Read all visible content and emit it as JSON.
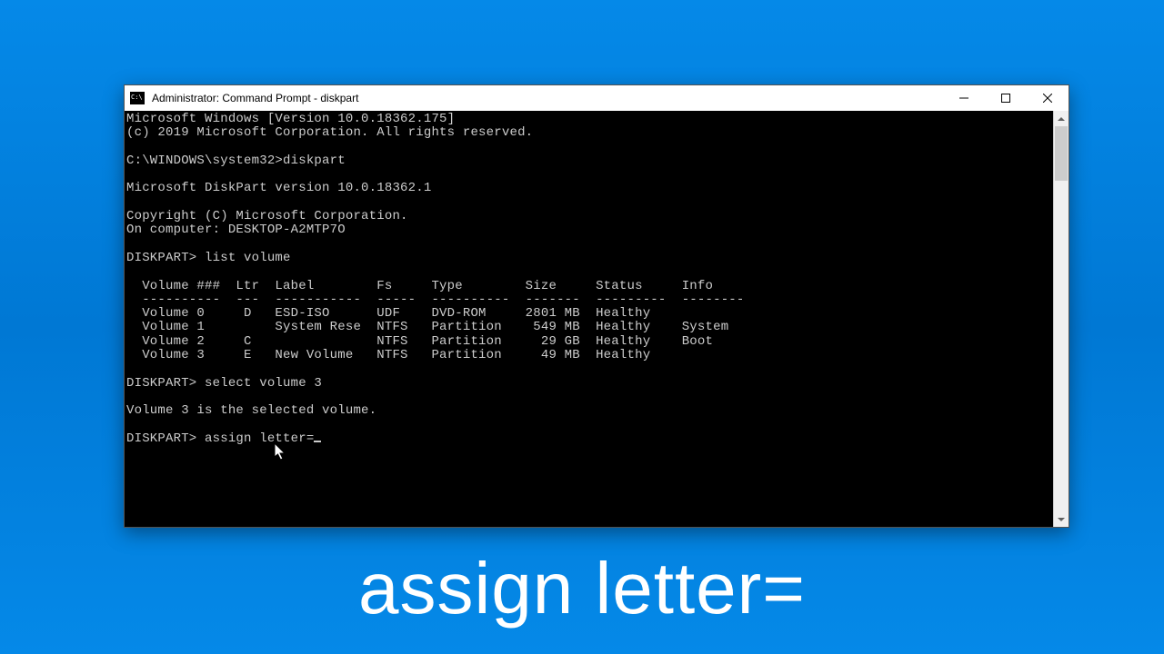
{
  "window": {
    "title": "Administrator: Command Prompt - diskpart"
  },
  "terminal": {
    "lines": [
      "Microsoft Windows [Version 10.0.18362.175]",
      "(c) 2019 Microsoft Corporation. All rights reserved.",
      "",
      "C:\\WINDOWS\\system32>diskpart",
      "",
      "Microsoft DiskPart version 10.0.18362.1",
      "",
      "Copyright (C) Microsoft Corporation.",
      "On computer: DESKTOP-A2MTP7O",
      "",
      "DISKPART> list volume",
      "",
      "  Volume ###  Ltr  Label        Fs     Type        Size     Status     Info",
      "  ----------  ---  -----------  -----  ----------  -------  ---------  --------",
      "  Volume 0     D   ESD-ISO      UDF    DVD-ROM     2801 MB  Healthy",
      "  Volume 1         System Rese  NTFS   Partition    549 MB  Healthy    System",
      "  Volume 2     C                NTFS   Partition     29 GB  Healthy    Boot",
      "  Volume 3     E   New Volume   NTFS   Partition     49 MB  Healthy",
      "",
      "DISKPART> select volume 3",
      "",
      "Volume 3 is the selected volume.",
      "",
      "DISKPART> assign letter="
    ],
    "prompt_prefix": "DISKPART> ",
    "current_input": "assign letter="
  },
  "volumes": [
    {
      "num": 0,
      "ltr": "D",
      "label": "ESD-ISO",
      "fs": "UDF",
      "type": "DVD-ROM",
      "size": "2801 MB",
      "status": "Healthy",
      "info": ""
    },
    {
      "num": 1,
      "ltr": "",
      "label": "System Rese",
      "fs": "NTFS",
      "type": "Partition",
      "size": "549 MB",
      "status": "Healthy",
      "info": "System"
    },
    {
      "num": 2,
      "ltr": "C",
      "label": "",
      "fs": "NTFS",
      "type": "Partition",
      "size": "29 GB",
      "status": "Healthy",
      "info": "Boot"
    },
    {
      "num": 3,
      "ltr": "E",
      "label": "New Volume",
      "fs": "NTFS",
      "type": "Partition",
      "size": "49 MB",
      "status": "Healthy",
      "info": ""
    }
  ],
  "caption": "assign letter="
}
